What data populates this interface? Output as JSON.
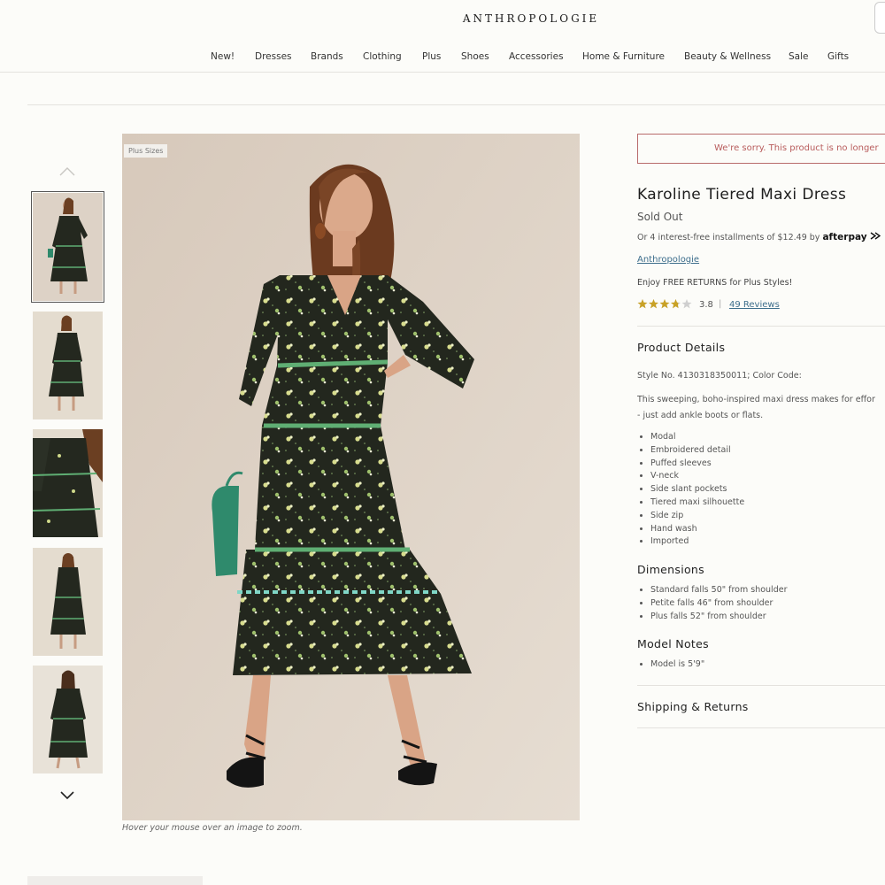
{
  "header": {
    "logo": "ANTHROPOLOGIE",
    "nav": [
      "New!",
      "Dresses",
      "Brands",
      "Clothing",
      "Plus",
      "Shoes",
      "Accessories",
      "Home & Furniture",
      "Beauty & Wellness",
      "Sale",
      "Gifts"
    ]
  },
  "gallery": {
    "badge": "Plus Sizes",
    "zoom_hint": "Hover your mouse over an image to zoom.",
    "thumb_count": 5,
    "selected_index": 0
  },
  "product": {
    "unavailable_notice": "We're sorry. This product is no longer",
    "title": "Karoline Tiered Maxi Dress",
    "status": "Sold Out",
    "installments_text": "Or 4 interest-free installments of $12.49 by",
    "afterpay_label": "afterpay",
    "brand": "Anthropologie",
    "returns_text": "Enjoy FREE RETURNS for Plus Styles!",
    "rating": 3.8,
    "rating_text": "3.8",
    "reviews_link": "49 Reviews"
  },
  "details": {
    "heading": "Product Details",
    "style_line": "Style No. 4130318350011; Color Code:",
    "description_line1": "This sweeping, boho-inspired maxi dress makes for effor",
    "description_line2": "- just add ankle boots or flats.",
    "features": [
      "Modal",
      "Embroidered detail",
      "Puffed sleeves",
      "V-neck",
      "Side slant pockets",
      "Tiered maxi silhouette",
      "Side zip",
      "Hand wash",
      "Imported"
    ]
  },
  "dimensions": {
    "heading": "Dimensions",
    "items": [
      "Standard falls 50\" from shoulder",
      "Petite falls 46\" from shoulder",
      "Plus falls 52\" from shoulder"
    ]
  },
  "model_notes": {
    "heading": "Model Notes",
    "items": [
      "Model is 5'9\""
    ]
  },
  "shipping": {
    "heading": "Shipping & Returns"
  },
  "colors": {
    "accent_link": "#3d6e8c",
    "error": "#b85c5c",
    "star": "#c9a227",
    "dress": "#24281f",
    "trim": "#5fae73",
    "bag": "#2f8a6c"
  }
}
